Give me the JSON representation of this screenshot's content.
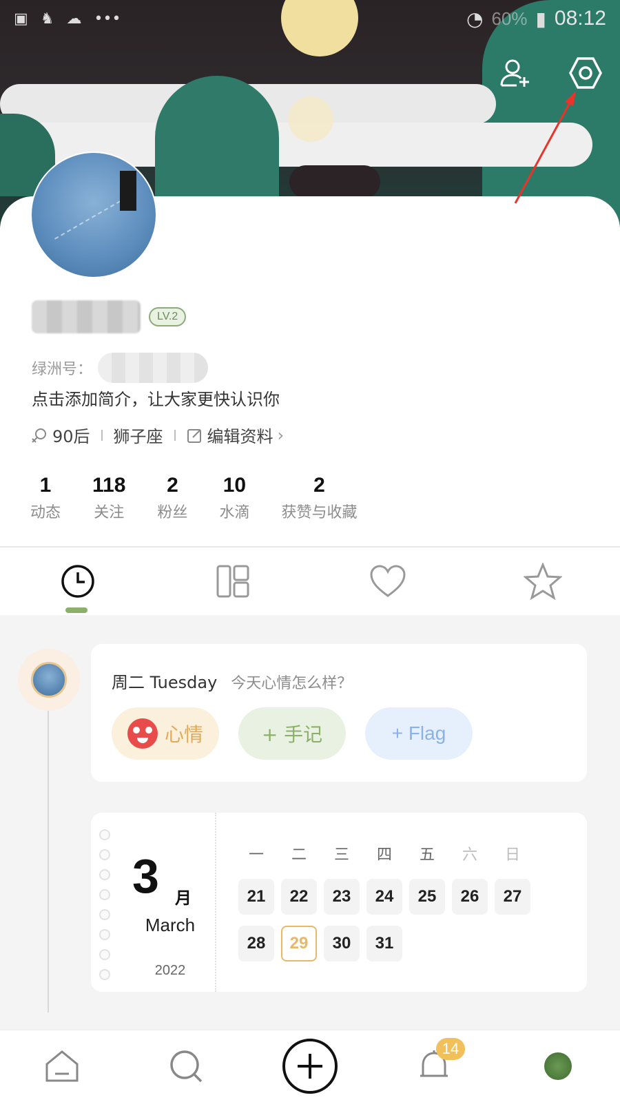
{
  "status_bar": {
    "left_icons": [
      "gallery-icon",
      "app-icon",
      "cloud-icon",
      "more-icon"
    ],
    "signal": "60%",
    "time": "08:12"
  },
  "header_actions": {
    "add_friend_icon": "person-add-icon",
    "settings_icon": "hexagon-gear-icon"
  },
  "profile": {
    "level": "LV.2",
    "oasis_id_label": "绿洲号：",
    "bio": "点击添加简介，让大家更快认识你",
    "tags": {
      "age": "90后",
      "zodiac": "狮子座",
      "edit": "编辑资料"
    }
  },
  "stats": [
    {
      "num": "1",
      "label": "动态"
    },
    {
      "num": "118",
      "label": "关注"
    },
    {
      "num": "2",
      "label": "粉丝"
    },
    {
      "num": "10",
      "label": "水滴"
    },
    {
      "num": "2",
      "label": "获赞与收藏"
    }
  ],
  "tabs": [
    {
      "icon": "clock-icon",
      "active": true
    },
    {
      "icon": "grid-icon",
      "active": false
    },
    {
      "icon": "heart-icon",
      "active": false
    },
    {
      "icon": "star-icon",
      "active": false
    }
  ],
  "mood_card": {
    "day": "周二 Tuesday",
    "prompt": "今天心情怎么样？",
    "buttons": [
      "心情",
      "+ 手记",
      "+ Flag"
    ]
  },
  "calendar": {
    "month_num": "3",
    "month_cn": "月",
    "month_en": "March",
    "year": "2022",
    "weekdays": [
      "一",
      "二",
      "三",
      "四",
      "五",
      "六",
      "日"
    ],
    "days_row1": [
      "21",
      "22",
      "23",
      "24",
      "25",
      "26",
      "27"
    ],
    "days_row2": [
      "28",
      "29",
      "30",
      "31"
    ],
    "today": "29"
  },
  "bottom_nav": {
    "notification_badge": "14"
  },
  "colors": {
    "accent_green": "#8ab06a",
    "today_orange": "#e8b86a",
    "badge_yellow": "#f1c05a"
  }
}
